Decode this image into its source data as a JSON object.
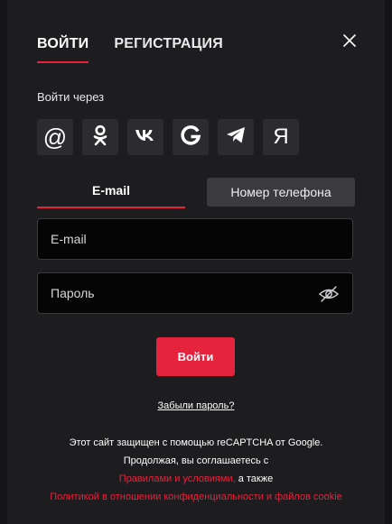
{
  "tabs": {
    "login": "ВОЙТИ",
    "register": "РЕГИСТРАЦИЯ"
  },
  "social": {
    "label": "Войти через",
    "items": [
      {
        "name": "mail",
        "glyph": "@"
      },
      {
        "name": "ok",
        "glyph": ""
      },
      {
        "name": "vk",
        "glyph": ""
      },
      {
        "name": "google",
        "glyph": ""
      },
      {
        "name": "telegram",
        "glyph": ""
      },
      {
        "name": "yandex",
        "glyph": "Я"
      }
    ]
  },
  "methods": {
    "email": "E-mail",
    "phone": "Номер телефона"
  },
  "fields": {
    "email_placeholder": "E-mail",
    "password_placeholder": "Пароль"
  },
  "submit_label": "Войти",
  "forgot_label": "Забыли пароль?",
  "legal": {
    "line1": "Этот сайт защищен с помощью reCAPTCHA от Google.",
    "line2": "Продолжая, вы соглашаетесь с",
    "terms_link": "Правилами и условиями,",
    "also": " а также",
    "privacy_link": "Политикой в отношении конфиденциальности и файлов cookie"
  },
  "colors": {
    "accent": "#e5233c",
    "background": "#1d1d1f",
    "field_bg": "#050506"
  }
}
